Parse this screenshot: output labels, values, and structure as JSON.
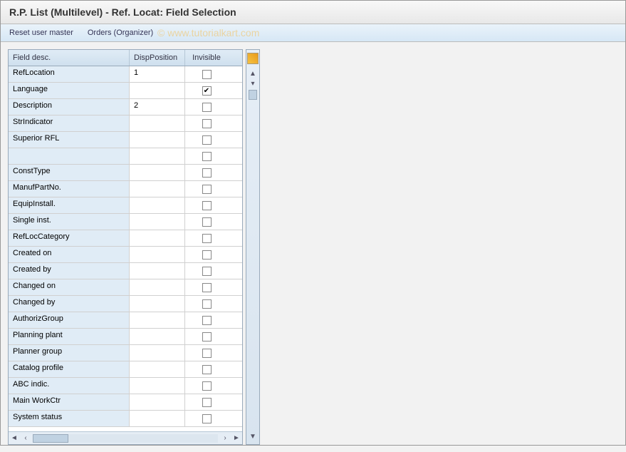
{
  "window": {
    "title": "R.P. List (Multilevel) - Ref. Locat: Field Selection"
  },
  "toolbar": {
    "reset_label": "Reset user master",
    "orders_label": "Orders (Organizer)"
  },
  "watermark": "©  www.tutorialkart.com",
  "table": {
    "headers": {
      "field": "Field desc.",
      "disp": "DispPosition",
      "inv": "Invisible"
    },
    "rows": [
      {
        "field": "RefLocation",
        "disp": "1",
        "inv": false
      },
      {
        "field": "Language",
        "disp": "",
        "inv": true
      },
      {
        "field": "Description",
        "disp": "2",
        "inv": false
      },
      {
        "field": "StrIndicator",
        "disp": "",
        "inv": false
      },
      {
        "field": "Superior RFL",
        "disp": "",
        "inv": false
      },
      {
        "field": "",
        "disp": "",
        "inv": false
      },
      {
        "field": "ConstType",
        "disp": "",
        "inv": false
      },
      {
        "field": "ManufPartNo.",
        "disp": "",
        "inv": false
      },
      {
        "field": "EquipInstall.",
        "disp": "",
        "inv": false
      },
      {
        "field": "Single inst.",
        "disp": "",
        "inv": false
      },
      {
        "field": "RefLocCategory",
        "disp": "",
        "inv": false
      },
      {
        "field": "Created on",
        "disp": "",
        "inv": false
      },
      {
        "field": "Created by",
        "disp": "",
        "inv": false
      },
      {
        "field": "Changed on",
        "disp": "",
        "inv": false
      },
      {
        "field": "Changed by",
        "disp": "",
        "inv": false
      },
      {
        "field": "AuthorizGroup",
        "disp": "",
        "inv": false
      },
      {
        "field": "Planning plant",
        "disp": "",
        "inv": false
      },
      {
        "field": "Planner group",
        "disp": "",
        "inv": false
      },
      {
        "field": "Catalog profile",
        "disp": "",
        "inv": false
      },
      {
        "field": "ABC indic.",
        "disp": "",
        "inv": false
      },
      {
        "field": "Main WorkCtr",
        "disp": "",
        "inv": false
      },
      {
        "field": "System status",
        "disp": "",
        "inv": false
      }
    ]
  }
}
